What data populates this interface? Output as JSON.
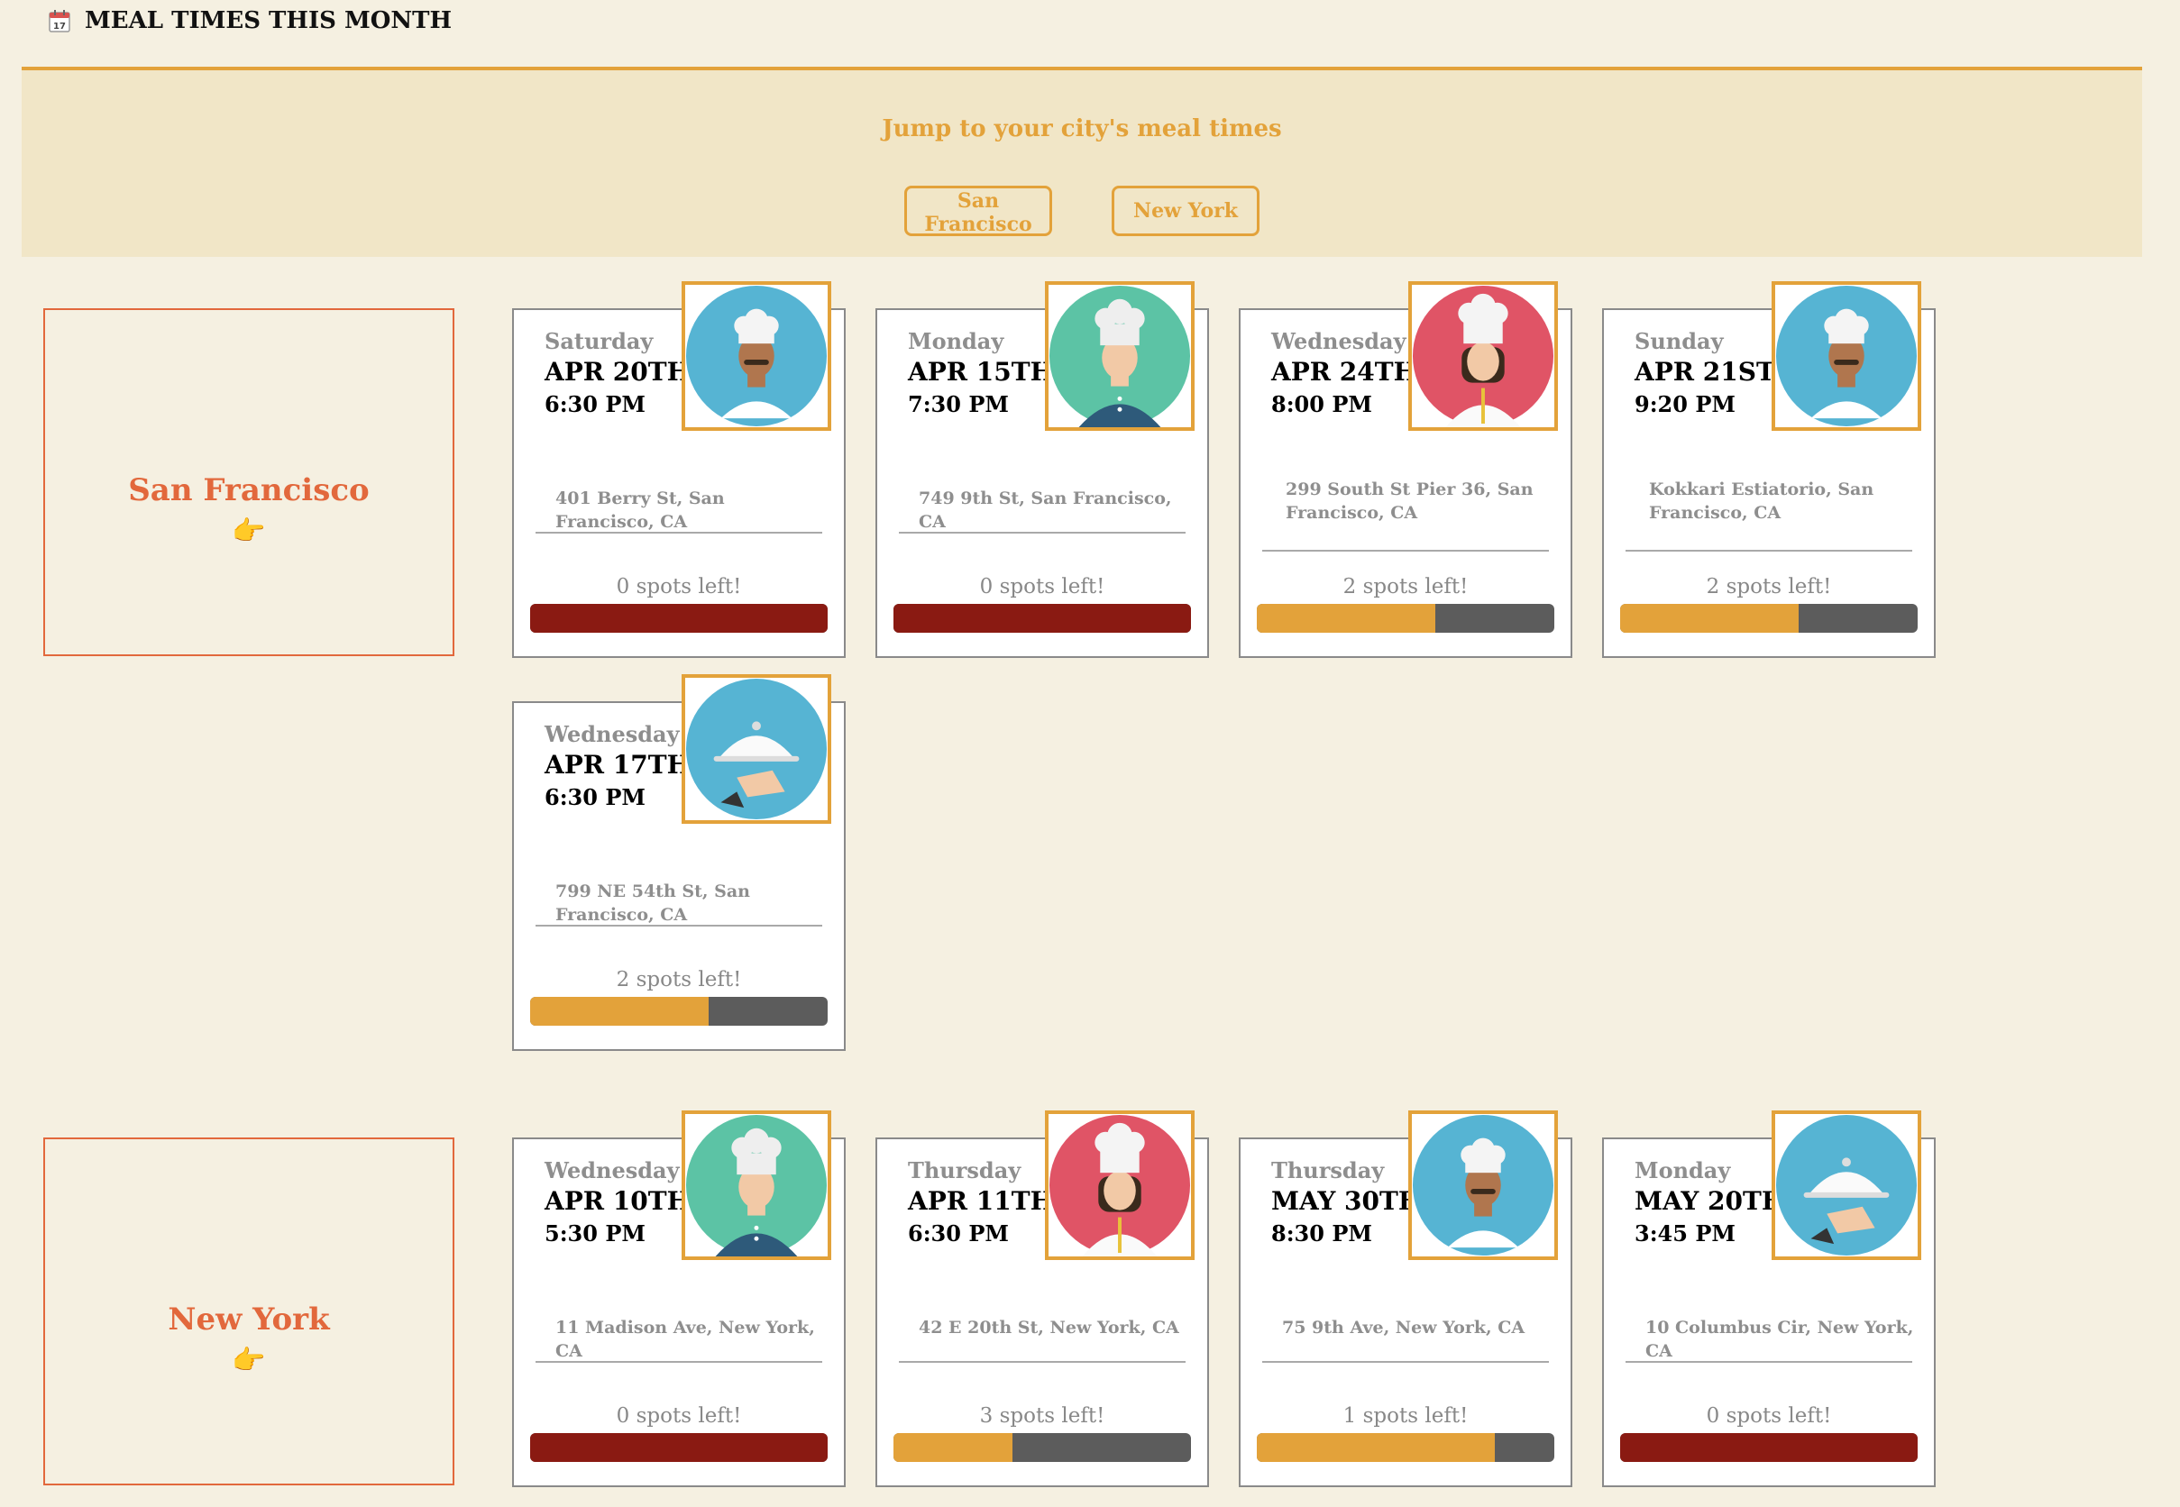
{
  "header": {
    "title": "MEAL TIMES THIS MONTH",
    "icon": "calendar-icon"
  },
  "jump": {
    "text": "Jump to your city's meal times",
    "buttons": [
      "San Francisco",
      "New York"
    ]
  },
  "colors": {
    "accent": "#e3a23a",
    "city": "#e2683c",
    "full": "#8a1a12",
    "bar_bg": "#5c5c5c",
    "background": "#f5f0e1"
  },
  "sections": [
    {
      "city": "San Francisco",
      "hand": "👉",
      "cards": [
        {
          "day": "Saturday",
          "date": "APR 20TH",
          "time": "6:30 PM",
          "address": "401 Berry St, San Francisco, CA",
          "spots": "0 spots left!",
          "filled": 1.0,
          "avatar": "chef-mustache-icon",
          "avatar_bg": "#56b4d3"
        },
        {
          "day": "Monday",
          "date": "APR 15TH",
          "time": "7:30 PM",
          "address": "749 9th St, San Francisco, CA",
          "spots": "0 spots left!",
          "filled": 1.0,
          "avatar": "chef-young-icon",
          "avatar_bg": "#5cc3a5"
        },
        {
          "day": "Wednesday",
          "date": "APR 24TH",
          "time": "8:00 PM",
          "address": "299 South St Pier 36, San Francisco, CA",
          "spots": "2 spots left!",
          "filled": 0.6,
          "avatar": "chef-woman-icon",
          "avatar_bg": "#e05466"
        },
        {
          "day": "Sunday",
          "date": "APR 21ST",
          "time": "9:20 PM",
          "address": "Kokkari Estiatorio, San Francisco, CA",
          "spots": "2 spots left!",
          "filled": 0.6,
          "avatar": "chef-mustache-icon",
          "avatar_bg": "#56b4d3"
        },
        {
          "day": "Wednesday",
          "date": "APR 17TH",
          "time": "6:30 PM",
          "address": "799 NE 54th St, San Francisco, CA",
          "spots": "2 spots left!",
          "filled": 0.6,
          "avatar": "cloche-icon",
          "avatar_bg": "#56b4d3"
        }
      ]
    },
    {
      "city": "New York",
      "hand": "👉",
      "cards": [
        {
          "day": "Wednesday",
          "date": "APR 10TH",
          "time": "5:30 PM",
          "address": "11 Madison Ave, New York, CA",
          "spots": "0 spots left!",
          "filled": 1.0,
          "avatar": "chef-young-icon",
          "avatar_bg": "#5cc3a5"
        },
        {
          "day": "Thursday",
          "date": "APR 11TH",
          "time": "6:30 PM",
          "address": "42 E 20th St, New York, CA",
          "spots": "3 spots left!",
          "filled": 0.4,
          "avatar": "chef-woman-icon",
          "avatar_bg": "#e05466"
        },
        {
          "day": "Thursday",
          "date": "MAY 30TH",
          "time": "8:30 PM",
          "address": "75 9th Ave, New York, CA",
          "spots": "1 spots left!",
          "filled": 0.8,
          "avatar": "chef-mustache-icon",
          "avatar_bg": "#56b4d3"
        },
        {
          "day": "Monday",
          "date": "MAY 20TH",
          "time": "3:45 PM",
          "address": "10 Columbus Cir, New York, CA",
          "spots": "0 spots left!",
          "filled": 1.0,
          "avatar": "cloche-icon",
          "avatar_bg": "#56b4d3"
        }
      ]
    }
  ]
}
